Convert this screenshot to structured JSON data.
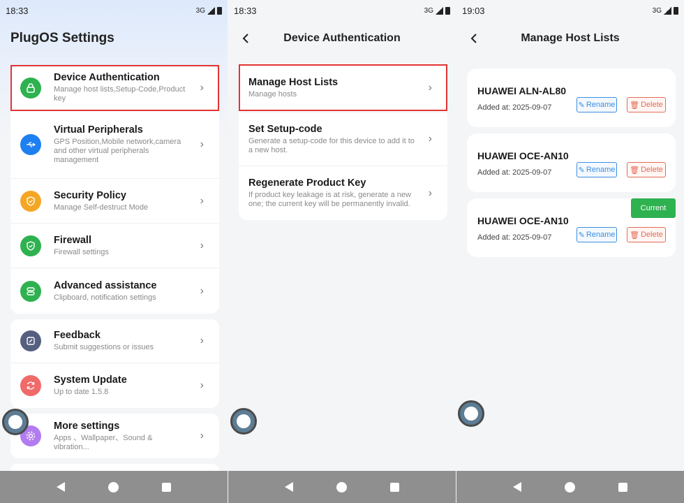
{
  "screen1": {
    "time": "18:33",
    "network": "3G",
    "app_title": "PlugOS Settings",
    "group1": [
      {
        "title": "Device Authentication",
        "subtitle": "Manage host lists,Setup-Code,Product key",
        "icon": "lock-icon",
        "color": "#2eb14f"
      },
      {
        "title": "Virtual Peripherals",
        "subtitle": "GPS Position,Mobile network,camera and other virtual peripherals management",
        "icon": "usb-icon",
        "color": "#1e7ff0"
      },
      {
        "title": "Security Policy",
        "subtitle": "Manage Self-destruct Mode",
        "icon": "shield-icon",
        "color": "#f5a623"
      },
      {
        "title": "Firewall",
        "subtitle": "Firewall settings",
        "icon": "shield-check-icon",
        "color": "#2eb14f"
      },
      {
        "title": "Advanced assistance",
        "subtitle": "Clipboard, notification settings",
        "icon": "assistance-icon",
        "color": "#2eb14f"
      }
    ],
    "group2": [
      {
        "title": "Feedback",
        "subtitle": "Submit suggestions or issues",
        "icon": "feedback-icon",
        "color": "#555f80"
      },
      {
        "title": "System Update",
        "subtitle": "Up to date 1.5.8",
        "icon": "refresh-icon",
        "color": "#f06a6a"
      }
    ],
    "group3": [
      {
        "title": "More settings",
        "subtitle": "Apps 、Wallpaper、Sound & vibration...",
        "icon": "gear-icon",
        "color": "#b27cf0"
      }
    ]
  },
  "screen2": {
    "time": "18:33",
    "network": "3G",
    "title": "Device Authentication",
    "items": [
      {
        "title": "Manage Host Lists",
        "subtitle": "Manage hosts"
      },
      {
        "title": "Set Setup-code",
        "subtitle": "Generate a setup-code for this device to add it to a new host."
      },
      {
        "title": "Regenerate Product Key",
        "subtitle": "If product key leakage is at risk, generate a new one; the current key will be permanently invalid."
      }
    ]
  },
  "screen3": {
    "time": "19:03",
    "network": "3G",
    "title": "Manage Host Lists",
    "rename_label": "Rename",
    "delete_label": "Delete",
    "current_label": "Current",
    "hosts": [
      {
        "name": "HUAWEI ALN-AL80",
        "added": "Added at: 2025-09-07"
      },
      {
        "name": "HUAWEI OCE-AN10",
        "added": "Added at: 2025-09-07"
      },
      {
        "name": "HUAWEI OCE-AN10",
        "added": "Added at: 2025-09-07"
      }
    ]
  }
}
